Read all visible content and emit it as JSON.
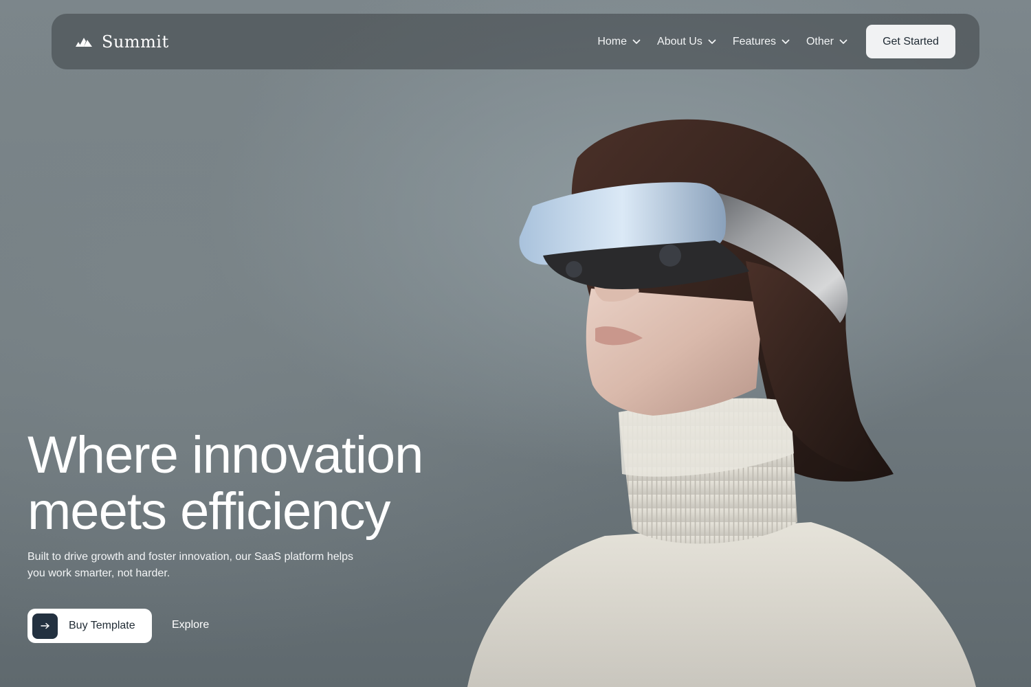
{
  "brand": {
    "name": "Summit",
    "logo_icon": "mountain-logo-icon"
  },
  "nav": {
    "items": [
      {
        "label": "Home",
        "icon": "chevron-down-icon"
      },
      {
        "label": "About Us",
        "icon": "chevron-down-icon"
      },
      {
        "label": "Features",
        "icon": "chevron-down-icon"
      },
      {
        "label": "Other",
        "icon": "chevron-down-icon"
      }
    ],
    "cta_label": "Get Started"
  },
  "hero": {
    "title_line1": "Where innovation",
    "title_line2": "meets efficiency",
    "subtitle": "Built to drive growth and foster innovation, our SaaS platform helps you work smarter, not harder.",
    "primary_button": {
      "label": "Buy Template",
      "icon": "arrow-right-icon"
    },
    "secondary_link": "Explore"
  },
  "colors": {
    "background": "#7d878c",
    "nav_background": "#3c4246",
    "button_light": "#f1f2f3",
    "button_icon_dark": "#233140",
    "text_dark": "#1f2a33"
  }
}
